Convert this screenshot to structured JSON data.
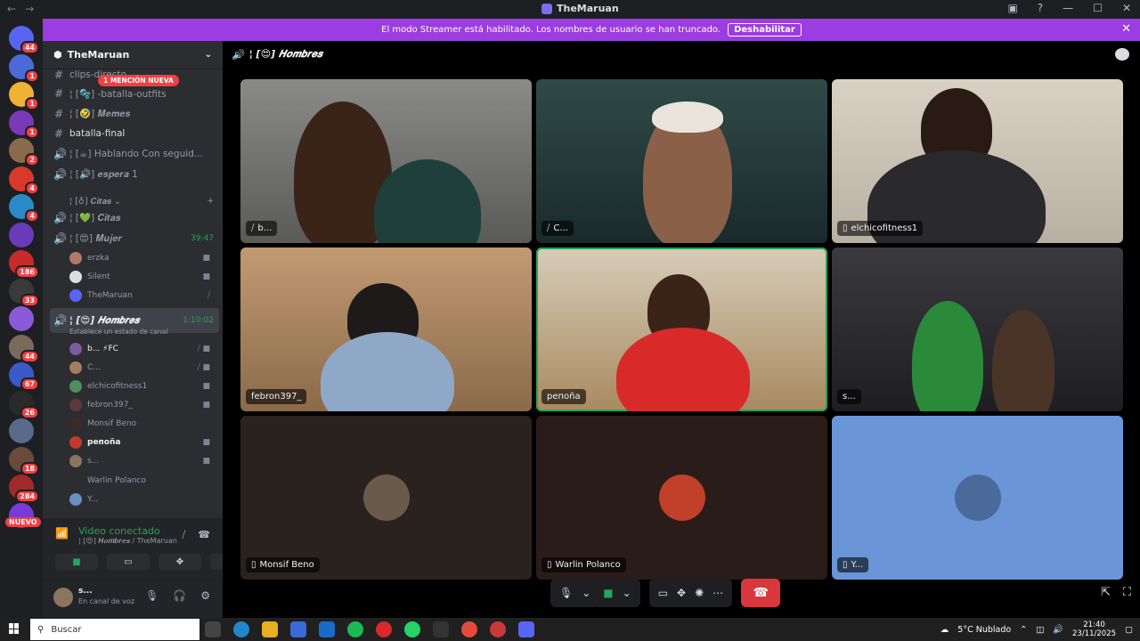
{
  "window": {
    "title": "TheMaruan"
  },
  "banner": {
    "text": "El modo Streamer está habilitado. Los nombres de usuario se han truncado.",
    "button": "Deshabilitar"
  },
  "server_badges": [
    "44",
    "1",
    "1",
    "1",
    "2",
    "4",
    "4",
    "",
    "186",
    "33",
    "",
    "44",
    "67",
    "26",
    "",
    "18",
    "284",
    ""
  ],
  "new_label": "NUEVO",
  "server": {
    "name": "TheMaruan",
    "mention": "1 MENCIÓN NUEVA",
    "channels": [
      {
        "sym": "#",
        "name": "clips-directo"
      },
      {
        "sym": "#",
        "name": "¦ [🫧] -batalla-outfits"
      },
      {
        "sym": "#",
        "name": "¦ [🤣] 𝑴𝒆𝒎𝒆𝒔"
      },
      {
        "sym": "#",
        "name": "batalla-final"
      },
      {
        "sym": "🔊",
        "name": "¦ [☕] Hablando Con seguid..."
      },
      {
        "sym": "🔊",
        "name": "¦ [🔊] 𝒆𝒔𝒑𝒆𝒓𝒂 1"
      },
      {
        "sym": "",
        "name": "¦ [♁] 𝑪𝒊𝒕𝒂𝒔 ⌄"
      },
      {
        "sym": "🔊",
        "name": "¦ [💚] 𝑪𝒊𝒕𝒂𝒔"
      },
      {
        "sym": "🔊",
        "name": "¦ [😍] 𝑴𝒖𝒋𝒆𝒓",
        "timer": "39:47"
      }
    ],
    "mujer_users": [
      "erzka",
      "Silent",
      "TheMaruan"
    ],
    "hombres": {
      "name": "¦ [😍] 𝑯𝒐𝒎𝒃𝒓𝒆𝒔",
      "timer": "1:10:02",
      "status_hint": "Establece un estado de canal"
    },
    "hombres_users": [
      "b... ⚡FC",
      "C...",
      "elchicofitness1",
      "febron397_",
      "Monsif Beno",
      "peпоña",
      "s...",
      "Warlin Polanco",
      "Y..."
    ]
  },
  "voice": {
    "status": "Video conectado",
    "channel": "¦ [😍] 𝑯𝒐𝒎𝒃𝒓𝒆𝒔 / TheMaruan"
  },
  "me": {
    "name": "s...",
    "status": "En canal de voz"
  },
  "stage": {
    "channel": "¦ [😍] 𝑯𝒐𝒎𝒃𝒓𝒆𝒔",
    "tiles": [
      {
        "label": "b...",
        "muted": true
      },
      {
        "label": "C...",
        "muted": true
      },
      {
        "label": "elchicofitness1",
        "mobile": true
      },
      {
        "label": "febron397_"
      },
      {
        "label": "peпоña",
        "active": true
      },
      {
        "label": "s..."
      },
      {
        "label": "Monsif Beno",
        "mobile": true
      },
      {
        "label": "Warlin Polanco",
        "mobile": true
      },
      {
        "label": "Y...",
        "mobile": true
      }
    ]
  },
  "taskbar": {
    "search": "Buscar",
    "weather": "5°C  Nublado",
    "time": "21:40",
    "date": "23/11/2025"
  },
  "colors": {
    "accent": "#9b3de0",
    "green": "#23a55a",
    "red": "#da373c"
  }
}
